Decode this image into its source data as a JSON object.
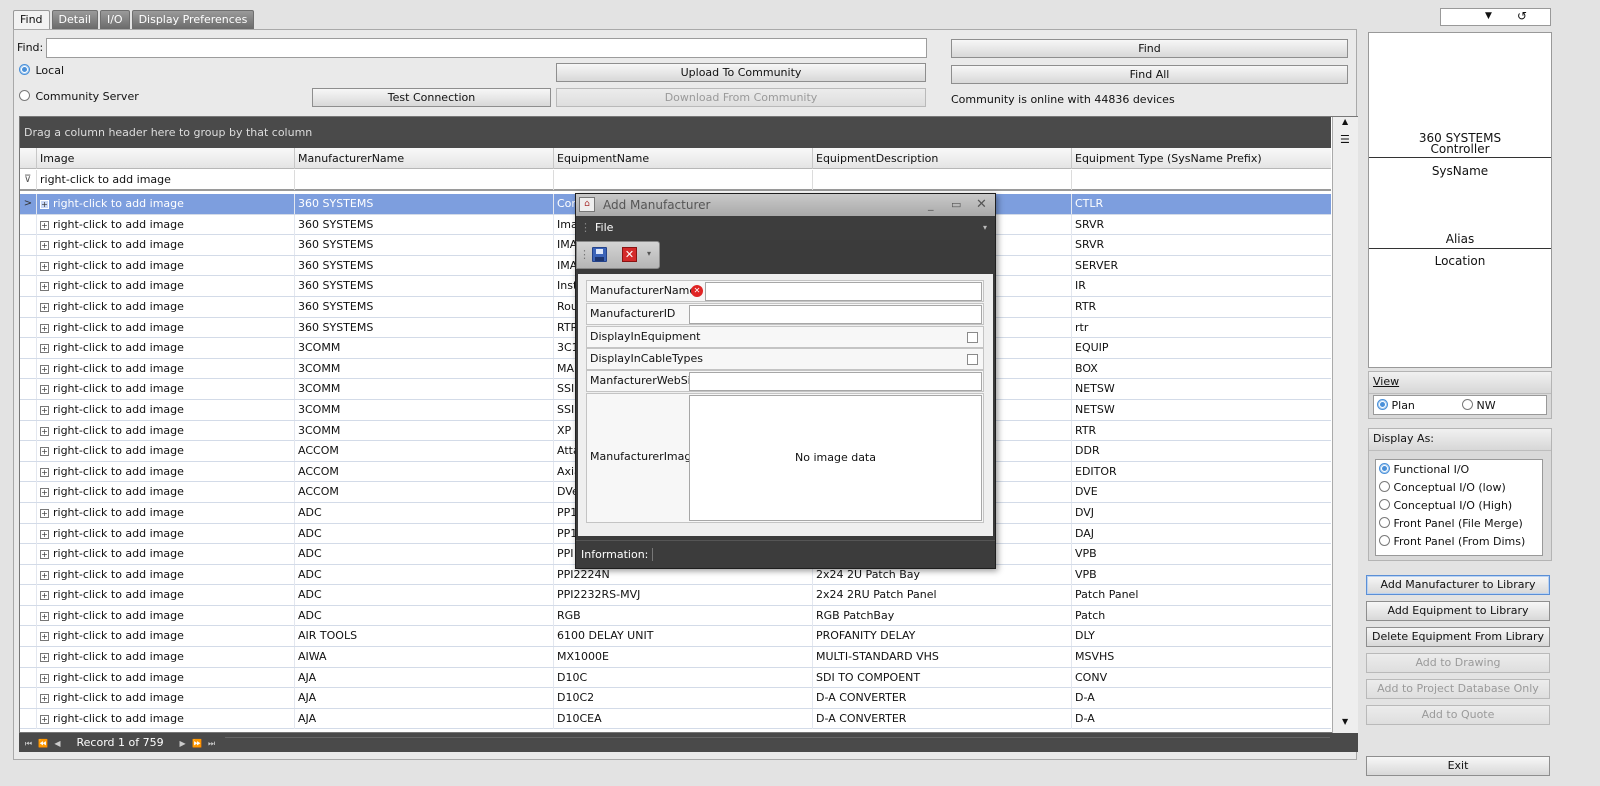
{
  "tabs": [
    "Find",
    "Detail",
    "I/O",
    "Display Preferences"
  ],
  "find": {
    "label": "Find:",
    "value": "",
    "local_label": "Local",
    "community_label": "Community Server",
    "buttons": {
      "find": "Find",
      "find_all": "Find All",
      "upload": "Upload To Community",
      "download": "Download From Community",
      "test": "Test Connection"
    },
    "status": "Community is online with 44836 devices"
  },
  "grid": {
    "group_hint": "Drag a column header here to group by that column",
    "columns": [
      "Image",
      "ManufacturerName",
      "EquipmentName",
      "EquipmentDescription",
      "Equipment Type (SysName Prefix)"
    ],
    "filter_text": "right-click to add image",
    "rows": [
      [
        "right-click to add image",
        "360 SYSTEMS",
        "Cor",
        "",
        "CTLR"
      ],
      [
        "right-click to add image",
        "360 SYSTEMS",
        "Ima",
        "",
        "SRVR"
      ],
      [
        "right-click to add image",
        "360 SYSTEMS",
        "IMA",
        "",
        "SRVR"
      ],
      [
        "right-click to add image",
        "360 SYSTEMS",
        "IMA",
        "",
        "SERVER"
      ],
      [
        "right-click to add image",
        "360 SYSTEMS",
        "Inst",
        "",
        "IR"
      ],
      [
        "right-click to add image",
        "360 SYSTEMS",
        "Rou",
        "",
        "RTR"
      ],
      [
        "right-click to add image",
        "360 SYSTEMS",
        "RTR",
        "",
        "rtr"
      ],
      [
        "right-click to add image",
        "3COMM",
        "3C1",
        "",
        "EQUIP"
      ],
      [
        "right-click to add image",
        "3COMM",
        "MAI",
        "",
        "BOX"
      ],
      [
        "right-click to add image",
        "3COMM",
        "SSI",
        "",
        "NETSW"
      ],
      [
        "right-click to add image",
        "3COMM",
        "SSI",
        "",
        "NETSW"
      ],
      [
        "right-click to add image",
        "3COMM",
        "XP",
        "",
        "RTR"
      ],
      [
        "right-click to add image",
        "ACCOM",
        "Atta",
        "",
        "DDR"
      ],
      [
        "right-click to add image",
        "ACCOM",
        "Axia",
        "",
        "EDITOR"
      ],
      [
        "right-click to add image",
        "ACCOM",
        "DVe",
        "",
        "DVE"
      ],
      [
        "right-click to add image",
        "ADC",
        "PP1",
        "",
        "DVJ"
      ],
      [
        "right-click to add image",
        "ADC",
        "PP1",
        "",
        "DAJ"
      ],
      [
        "right-click to add image",
        "ADC",
        "PPI",
        "",
        "VPB"
      ],
      [
        "right-click to add image",
        "ADC",
        "PPI2224N",
        "2x24 2U Patch Bay",
        "VPB"
      ],
      [
        "right-click to add image",
        "ADC",
        "PPI2232RS-MVJ",
        "2x24 2RU Patch Panel",
        "Patch Panel"
      ],
      [
        "right-click to add image",
        "ADC",
        "RGB",
        "RGB PatchBay",
        "Patch"
      ],
      [
        "right-click to add image",
        "AIR TOOLS",
        "6100 DELAY UNIT",
        "PROFANITY DELAY",
        "DLY"
      ],
      [
        "right-click to add image",
        "AIWA",
        "MX1000E",
        "MULTI-STANDARD VHS",
        "MSVHS"
      ],
      [
        "right-click to add image",
        "AJA",
        "D10C",
        "SDI TO COMPOENT",
        "CONV"
      ],
      [
        "right-click to add image",
        "AJA",
        "D10C2",
        "D-A CONVERTER",
        "D-A"
      ],
      [
        "right-click to add image",
        "AJA",
        "D10CEA",
        "D-A CONVERTER",
        "D-A"
      ]
    ],
    "record_text": "Record 1 of 759"
  },
  "preview": {
    "manufacturer": "360 SYSTEMS",
    "type": "Controller",
    "sysname": "SysName",
    "alias": "Alias",
    "location": "Location"
  },
  "view": {
    "label": "View",
    "options": [
      "Plan",
      "NW"
    ]
  },
  "display_as": {
    "label": "Display As:",
    "options": [
      "Functional I/O",
      "Conceptual I/O (low)",
      "Conceptual I/O (High)",
      "Front Panel (File Merge)",
      "Front Panel (From Dims)"
    ]
  },
  "actions": {
    "add_manufacturer": "Add Manufacturer to Library",
    "add_equipment": "Add Equipment to Library",
    "delete_equipment": "Delete Equipment From Library",
    "add_drawing": "Add to Drawing",
    "add_project": "Add to Project Database Only",
    "add_quote": "Add to Quote",
    "exit": "Exit"
  },
  "dialog": {
    "title": "Add Manufacturer",
    "menu": "File",
    "fields": {
      "name": "ManufacturerName",
      "id": "ManufacturerID",
      "display_equipment": "DisplayInEquipment",
      "display_cable": "DisplayInCableTypes",
      "website": "ManfacturerWebSite",
      "image": "ManufacturerImage"
    },
    "no_image": "No image data",
    "info": "Information:"
  },
  "colors": {
    "selected_row": "#7d9ede",
    "dark_bar": "#4a4a4a",
    "error": "#e02424"
  }
}
